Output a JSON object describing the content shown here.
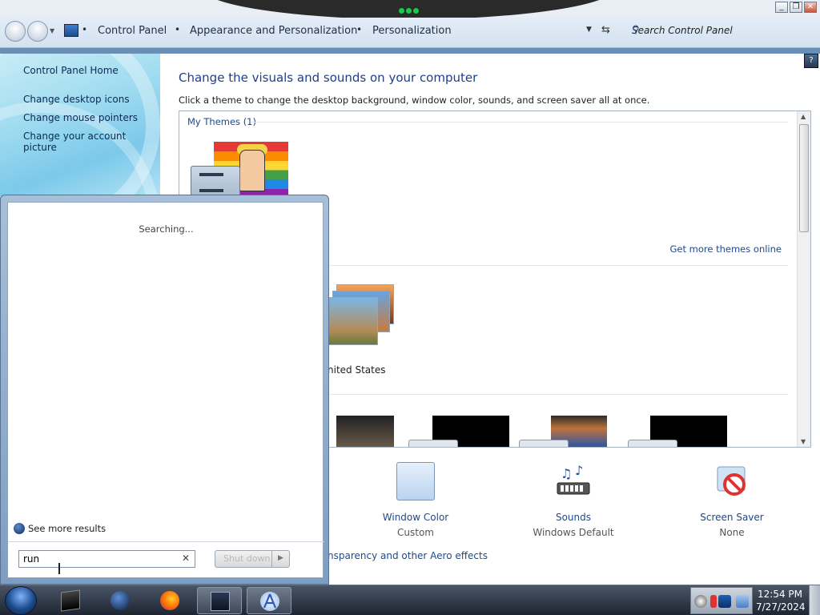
{
  "window": {
    "minimize_glyph": "_",
    "maximize_glyph": "❐",
    "close_glyph": "✕"
  },
  "address_bar": {
    "breadcrumbs": [
      "Control Panel",
      "Appearance and Personalization",
      "Personalization"
    ],
    "search_placeholder": "Search Control Panel"
  },
  "sidebar": {
    "home": "Control Panel Home",
    "links": [
      "Change desktop icons",
      "Change mouse pointers",
      "Change your account picture"
    ]
  },
  "main": {
    "title": "Change the visuals and sounds on your computer",
    "subtitle": "Click a theme to change the desktop background, window color, sounds, and screen saver all at once.",
    "my_themes_label": "My Themes (1)",
    "get_more_link": "Get more themes online",
    "aero_theme_label_fragment": "nited States",
    "help_glyph": "?",
    "controls": [
      {
        "label": "Window Color",
        "value": "Custom"
      },
      {
        "label": "Sounds",
        "value": "Windows Default"
      },
      {
        "label": "Screen Saver",
        "value": "None"
      }
    ],
    "aero_link_fragment": "nsparency and other Aero effects"
  },
  "start_menu": {
    "status": "Searching...",
    "see_more": "See more results",
    "search_value": "run",
    "shutdown_label": "Shut down"
  },
  "taskbar": {
    "time": "12:54 PM",
    "date": "7/27/2024"
  },
  "colors": {
    "link_blue": "#1c4a8c",
    "title_blue": "#1c3e8c",
    "taskbar_dark": "#1e2532"
  }
}
